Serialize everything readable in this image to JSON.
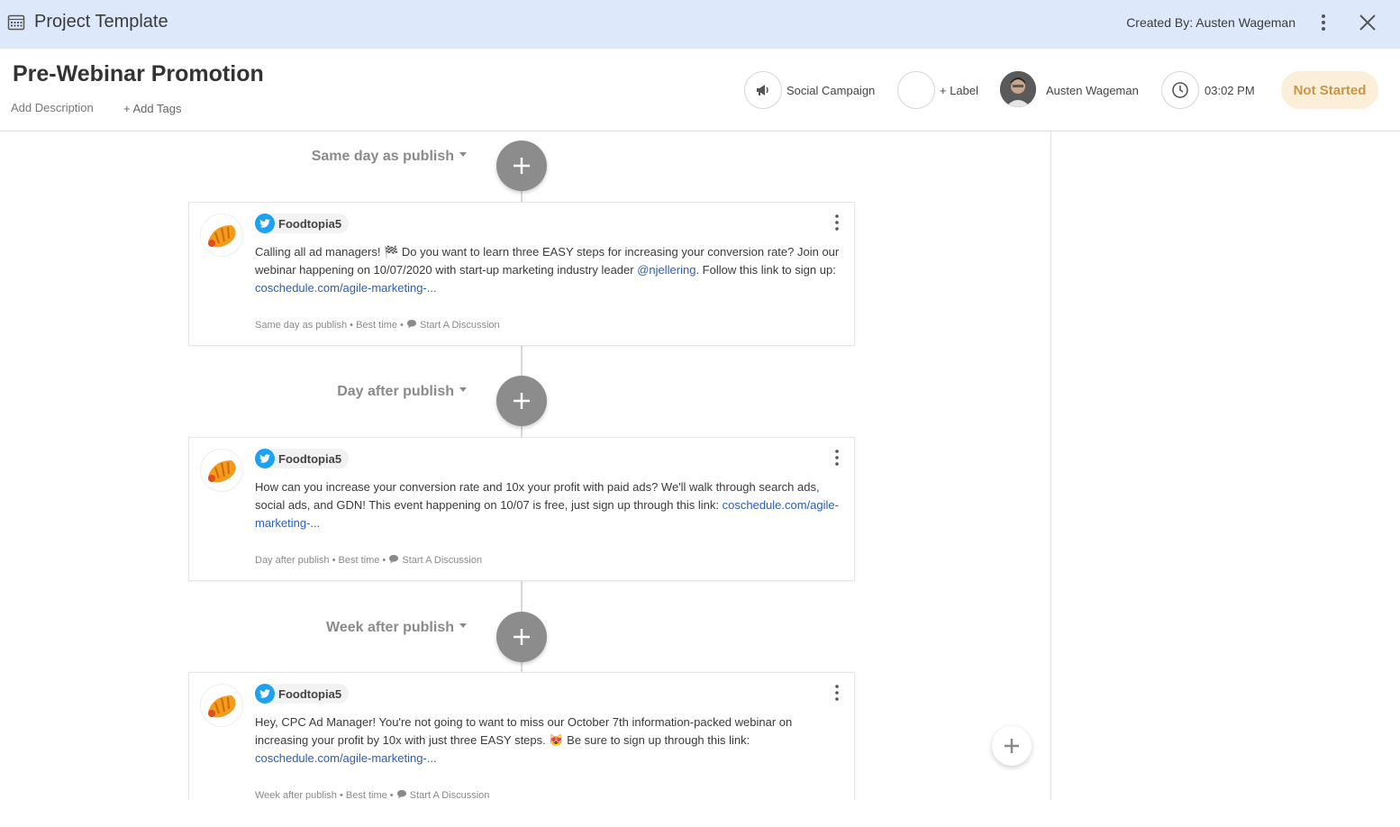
{
  "topbar": {
    "title": "Project Template",
    "created_by": "Created By: Austen Wageman"
  },
  "header": {
    "project_title": "Pre-Webinar Promotion",
    "add_description": "Add Description",
    "add_tags": "+ Add Tags",
    "campaign_type": "Social Campaign",
    "label": "+ Label",
    "owner": "Austen Wageman",
    "time": "03:02 PM",
    "status": "Not Started"
  },
  "steps": [
    {
      "label": "Same day as publish"
    },
    {
      "label": "Day after publish"
    },
    {
      "label": "Week after publish"
    }
  ],
  "posts": [
    {
      "account": "Foodtopia5",
      "text_a": "Calling all ad managers! 🏁 Do you want to learn three EASY steps for increasing your conversion rate? Join our webinar happening on 10/07/2020 with start-up marketing industry leader ",
      "mention": "@njellering",
      "text_b": ". Follow this link to sign up: ",
      "link": "coschedule.com/agile-marketing-...",
      "footer_timing": "Same day as publish",
      "footer_best": "Best time",
      "footer_discuss": "Start A Discussion"
    },
    {
      "account": "Foodtopia5",
      "text_a": "How can you increase your conversion rate and 10x your profit with paid ads? We'll walk through search ads, social ads, and GDN! This event happening on 10/07 is free, just sign up through this link: ",
      "link": "coschedule.com/agile-marketing-...",
      "footer_timing": "Day after publish",
      "footer_best": "Best time",
      "footer_discuss": "Start A Discussion"
    },
    {
      "account": "Foodtopia5",
      "text_a": "Hey, CPC Ad Manager! You're not going to want to miss our October 7th information-packed webinar on increasing your profit by 10x with just three EASY steps. 😻 Be sure to sign up through this link: ",
      "link": "coschedule.com/agile-marketing-...",
      "footer_timing": "Week after publish",
      "footer_best": "Best time",
      "footer_discuss": "Start A Discussion"
    }
  ],
  "colors": {
    "topbar_bg": "#dde8fb",
    "status_bg": "#fbefd9",
    "status_text": "#c99545",
    "link": "#2c5db3",
    "twitter": "#1da1f2",
    "plus_button": "#8c8c8c"
  }
}
